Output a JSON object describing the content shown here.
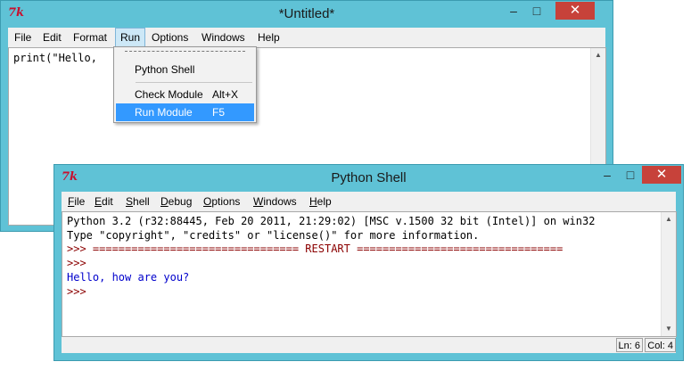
{
  "editor": {
    "title": "*Untitled*",
    "icon_text": "7k",
    "menu": [
      "File",
      "Edit",
      "Format",
      "Run",
      "Options",
      "Windows",
      "Help"
    ],
    "code_line": "print(\"Hello,"
  },
  "run_menu": {
    "items": [
      {
        "label": "Python Shell",
        "shortcut": ""
      },
      {
        "label": "Check Module",
        "shortcut": "Alt+X"
      },
      {
        "label": "Run Module",
        "shortcut": "F5"
      }
    ]
  },
  "shell": {
    "title": "Python Shell",
    "icon_text": "7k",
    "menu": [
      "File",
      "Edit",
      "Shell",
      "Debug",
      "Options",
      "Windows",
      "Help"
    ],
    "menu_underline": [
      "F",
      "E",
      "S",
      "D",
      "O",
      "W",
      "H"
    ],
    "lines": [
      "Python 3.2 (r32:88445, Feb 20 2011, 21:29:02) [MSC v.1500 32 bit (Intel)] on win32",
      "Type \"copyright\", \"credits\" or \"license()\" for more information.",
      ">>> ================================ RESTART ================================",
      ">>>",
      "Hello, how are you?",
      ">>>"
    ],
    "status_line": "Ln: 6",
    "status_col": "Col: 4"
  },
  "window_controls": {
    "minimize": "–",
    "maximize": "□",
    "close": "✕"
  },
  "colors": {
    "frame": "#5fc2d6",
    "prompt": "#8b0000",
    "output": "#0000cc",
    "string": "#00aa00",
    "highlight": "#3399ff",
    "close_button": "#c7423a"
  }
}
